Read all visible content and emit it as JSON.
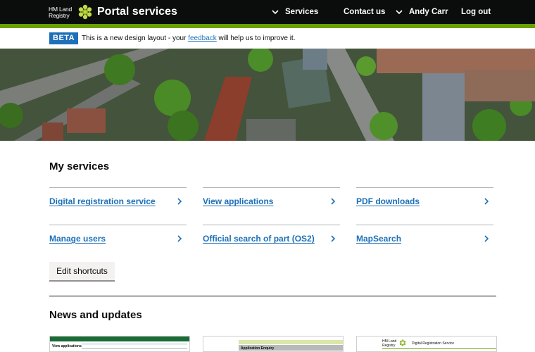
{
  "header": {
    "logo_line1": "HM Land",
    "logo_line2": "Registry",
    "service_name": "Portal services",
    "nav": {
      "services": "Services",
      "contact": "Contact us",
      "user": "Andy Carr",
      "logout": "Log out"
    }
  },
  "beta": {
    "tag": "BETA",
    "text_before": "This is a new design layout - your ",
    "link": "feedback",
    "text_after": " will help us to improve it."
  },
  "my_services": {
    "title": "My services",
    "items": [
      "Digital registration service",
      "View applications",
      "PDF downloads",
      "Manage users",
      "Official search of part (OS2)",
      "MapSearch"
    ],
    "edit_button": "Edit shortcuts"
  },
  "news": {
    "title": "News and updates",
    "thumbs": {
      "t1_line1": "View applications",
      "t2_line1": "Application Enquiry",
      "t3_logo": "HM Land Registry",
      "t3_title": "Digital Registration Service"
    }
  },
  "colors": {
    "header_bg": "#0b0c0c",
    "header_stripe": "#6aa000",
    "link": "#1d70b8",
    "beta_tag": "#1d70b8"
  }
}
